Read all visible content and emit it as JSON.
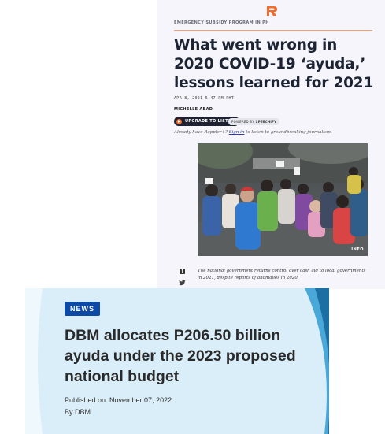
{
  "rappler": {
    "kicker": "EMERGENCY SUBSIDY PROGRAM IN PH",
    "title": "What went wrong in 2020 COVID-19 ‘ayuda,’ lessons learned for 2021",
    "date": "APR 8, 2021 5:47 PM PHT",
    "author": "MICHELLE ABAD",
    "listen_button": "UPGRADE TO LISTEN",
    "powered_by": "POWERED BY",
    "powered_brand": "SPEECHIFY",
    "already_prefix": "Already have Rappler+?",
    "sign_in": "Sign in",
    "already_suffix": "to listen to groundbreaking journalism.",
    "photo_badge": "INFO",
    "caption": "The national government returns control over cash aid to local governments in 2021, despite reports of anomalies in 2020",
    "colors": {
      "accent": "#f26b2a",
      "title": "#1c2434",
      "background": "#f5f5fb"
    }
  },
  "dbm": {
    "tag": "NEWS",
    "title": "DBM allocates P206.50 billion ayuda under the 2023 proposed national budget",
    "published": "Published on: November 07, 2022",
    "by": "By DBM",
    "colors": {
      "tag": "#0c4aa6",
      "panel": "#d9eef9",
      "curve_dark": "#1b6fa3",
      "curve_light": "#4aa8d8"
    }
  }
}
